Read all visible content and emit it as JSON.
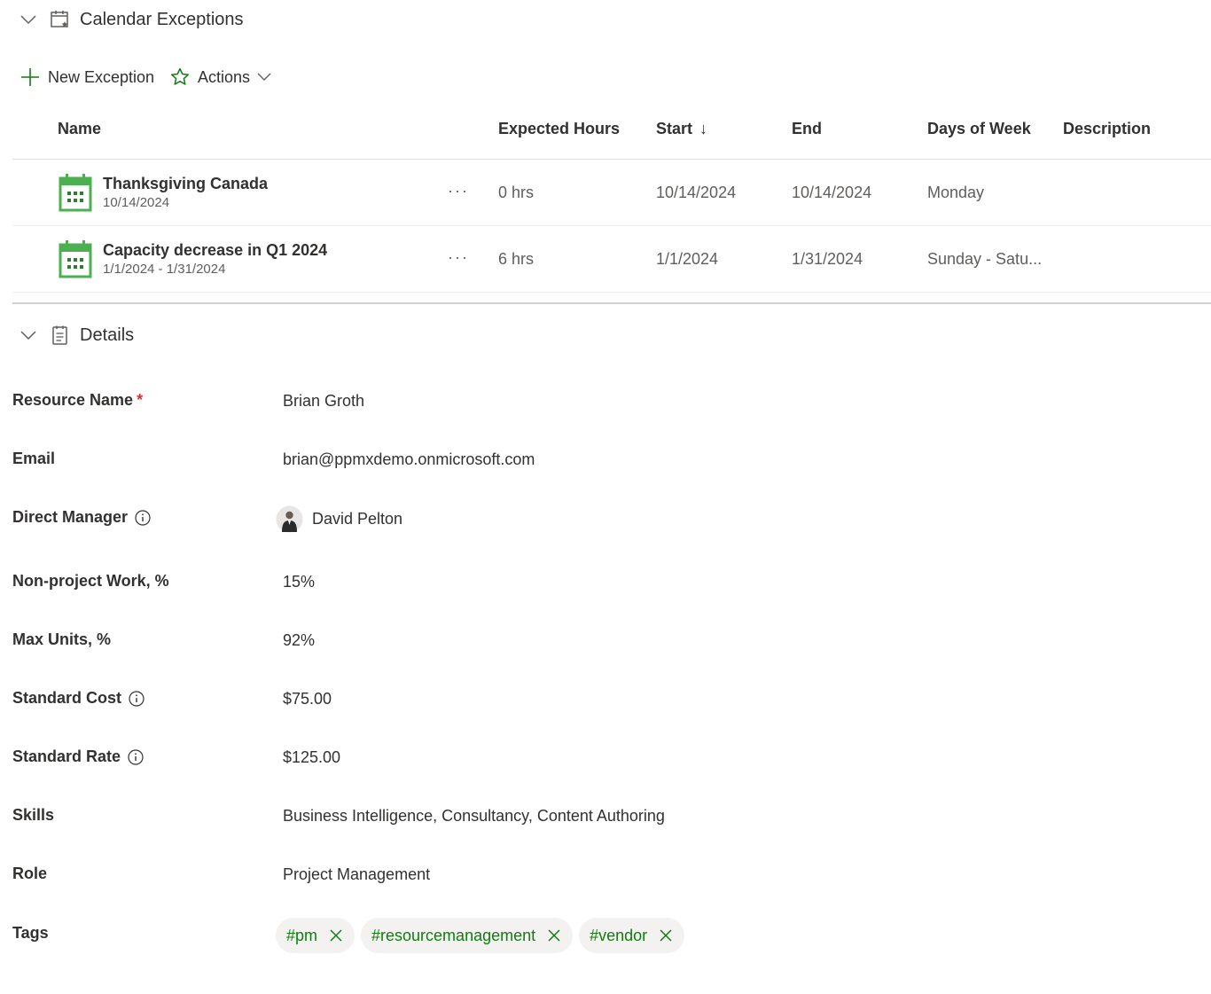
{
  "calendar_exceptions": {
    "title": "Calendar Exceptions",
    "toolbar": {
      "new_label": "New Exception",
      "actions_label": "Actions"
    },
    "columns": {
      "name": "Name",
      "expected_hours": "Expected Hours",
      "start": "Start",
      "start_sort": "↓",
      "end": "End",
      "days_of_week": "Days of Week",
      "description": "Description"
    },
    "rows": [
      {
        "title": "Thanksgiving Canada",
        "subtitle": "10/14/2024",
        "more": "···",
        "expected_hours": "0 hrs",
        "start": "10/14/2024",
        "end": "10/14/2024",
        "days_of_week": "Monday",
        "description": ""
      },
      {
        "title": "Capacity decrease in Q1 2024",
        "subtitle": "1/1/2024 - 1/31/2024",
        "more": "···",
        "expected_hours": "6 hrs",
        "start": "1/1/2024",
        "end": "1/31/2024",
        "days_of_week": "Sunday - Satu...",
        "description": ""
      }
    ]
  },
  "details": {
    "title": "Details",
    "fields": {
      "resource_name": {
        "label": "Resource Name",
        "required_mark": "*",
        "value": "Brian Groth"
      },
      "email": {
        "label": "Email",
        "value": "brian@ppmxdemo.onmicrosoft.com"
      },
      "direct_manager": {
        "label": "Direct Manager",
        "value": "David Pelton"
      },
      "non_project_work": {
        "label": "Non-project Work, %",
        "value": "15%"
      },
      "max_units": {
        "label": "Max Units, %",
        "value": "92%"
      },
      "standard_cost": {
        "label": "Standard Cost",
        "value": "$75.00"
      },
      "standard_rate": {
        "label": "Standard Rate",
        "value": "$125.00"
      },
      "skills": {
        "label": "Skills",
        "value": "Business Intelligence, Consultancy, Content Authoring"
      },
      "role": {
        "label": "Role",
        "value": "Project Management"
      },
      "tags": {
        "label": "Tags",
        "items": [
          "#pm",
          "#resourcemanagement",
          "#vendor"
        ]
      }
    }
  },
  "colors": {
    "accent_green": "#107c10",
    "calendar_icon_green": "#4caf50",
    "required_red": "#d13438"
  }
}
